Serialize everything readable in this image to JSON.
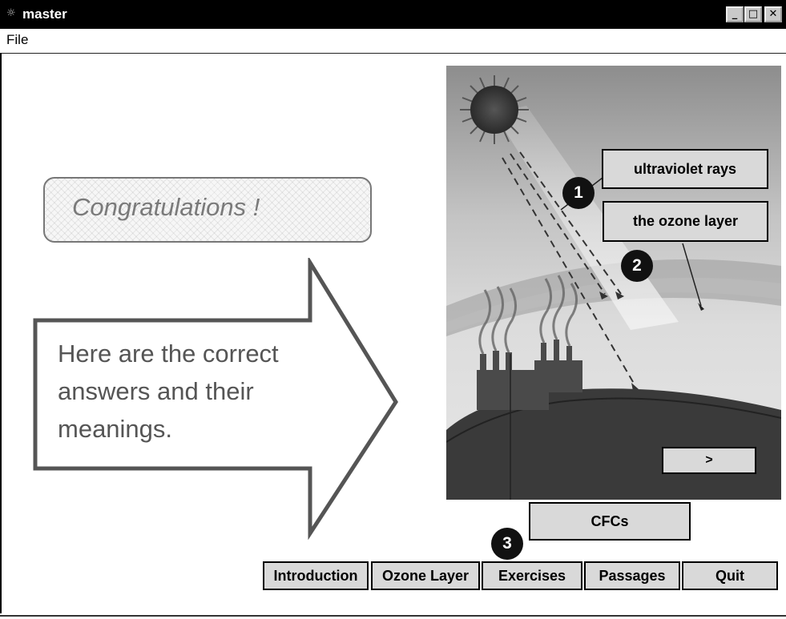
{
  "window": {
    "title": "master",
    "app_icon": "app-icon",
    "controls": {
      "minimize_icon": "minimize-icon",
      "maximize_icon": "maximize-icon",
      "close_icon": "close-icon"
    }
  },
  "menu": {
    "file": "File"
  },
  "main": {
    "congrats": "Congratulations !",
    "message": "Here are the correct answers and their meanings."
  },
  "illustration": {
    "labels": {
      "uv": "ultraviolet rays",
      "ozone": "the ozone layer",
      "cfc": "CFCs"
    },
    "badges": {
      "one": "1",
      "two": "2",
      "three": "3"
    },
    "next": ">"
  },
  "nav": {
    "introduction": "Introduction",
    "ozone_layer": "Ozone Layer",
    "exercises": "Exercises",
    "passages": "Passages",
    "quit": "Quit"
  }
}
